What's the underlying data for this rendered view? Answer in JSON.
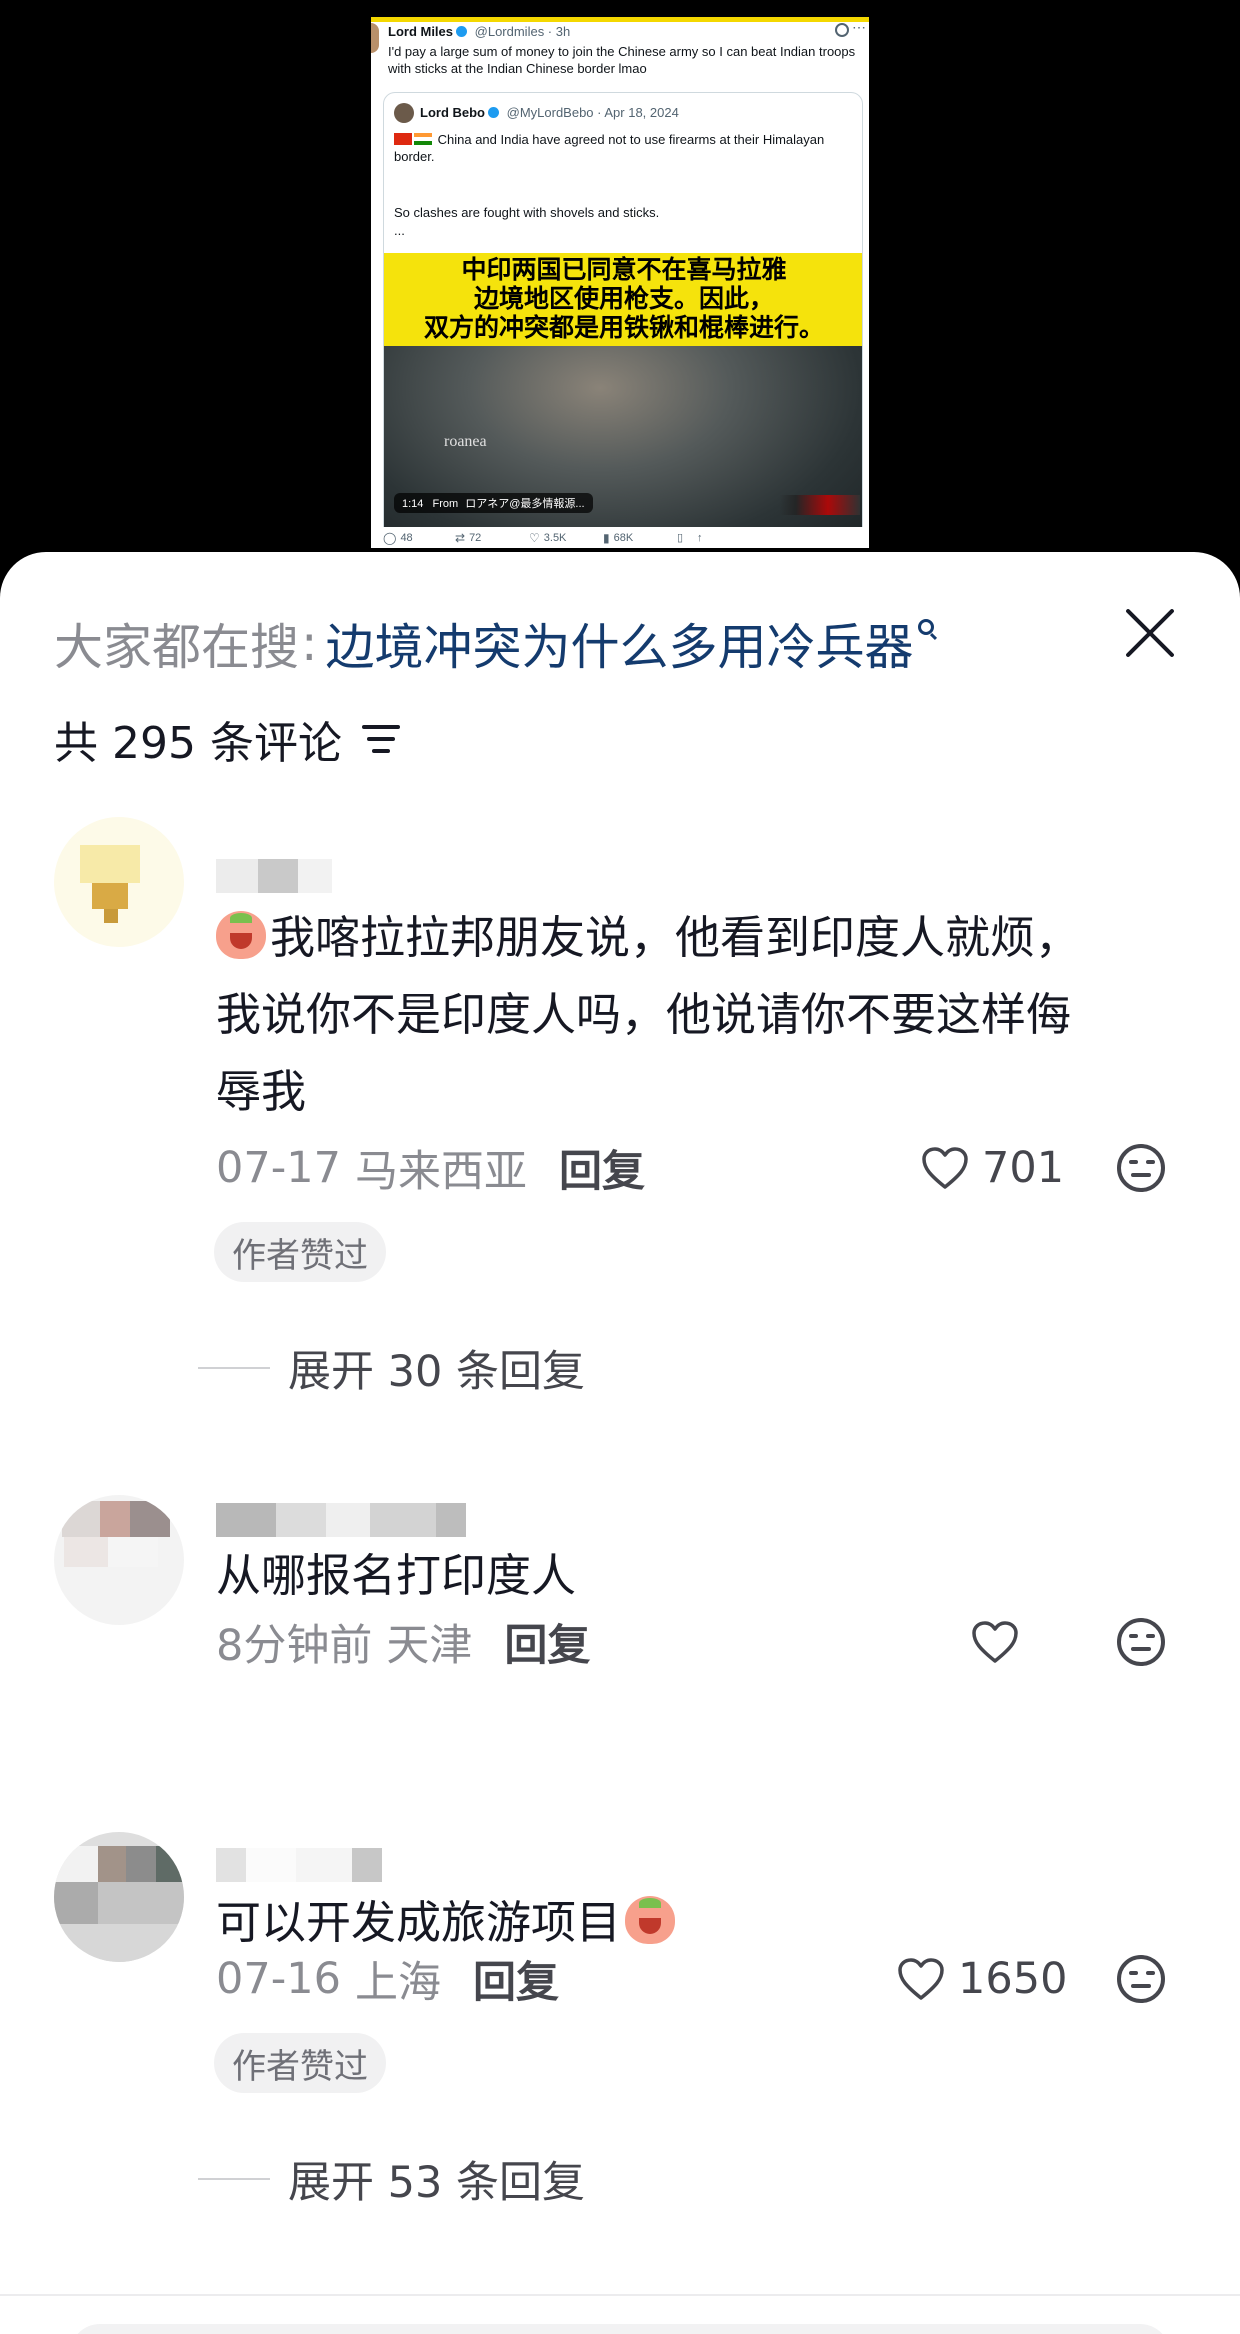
{
  "tweet": {
    "author_name": "Lord Miles",
    "author_handle": "@Lordmiles · 3h",
    "text": "I'd pay a large sum of money to join the Chinese army so I can beat Indian troops with sticks at the Indian Chinese border lmao",
    "quoted": {
      "author_name": "Lord Bebo",
      "author_handle": "@MyLordBebo · Apr 18, 2024",
      "text_line1": "China and India have agreed not to use firearms at their Himalayan border.",
      "text_line2": "So clashes are fought with shovels and sticks.",
      "ellipsis": "...",
      "video_caption": "中印两国已同意不在喜马拉雅\n边境地区使用枪支。因此，\n双方的冲突都是用铁锹和棍棒进行。",
      "watermark": "roanea",
      "duration": "1:14",
      "source_prefix": "From",
      "source_name": "ロアネア@最多情報源..."
    },
    "stats": {
      "replies": "48",
      "retweets": "72",
      "likes": "3.5K",
      "views": "68K"
    }
  },
  "search": {
    "prefix": "大家都在搜",
    "colon": ":",
    "keyword": "边境冲突为什么多用冷兵器"
  },
  "comment_count_label": "共 295 条评论",
  "comments": [
    {
      "text": "我喀拉拉邦朋友说，他看到印度人就烦，\n我说你不是印度人吗，他说请你不要这样侮\n辱我",
      "time": "07-17",
      "location": "马来西亚",
      "reply_label": "回复",
      "likes": "701",
      "author_liked": "作者赞过",
      "expand_label": "展开 30 条回复"
    },
    {
      "text": "从哪报名打印度人",
      "time": "8分钟前",
      "location": "天津",
      "reply_label": "回复",
      "likes": ""
    },
    {
      "text": "可以开发成旅游项目",
      "time": "07-16",
      "location": "上海",
      "reply_label": "回复",
      "likes": "1650",
      "author_liked": "作者赞过",
      "expand_label": "展开 53 条回复"
    }
  ],
  "colors": {
    "keyword_blue": "#143b6e",
    "caption_yellow": "#f5e30c",
    "text_dark": "#161823",
    "text_gray": "#8a8b91"
  }
}
